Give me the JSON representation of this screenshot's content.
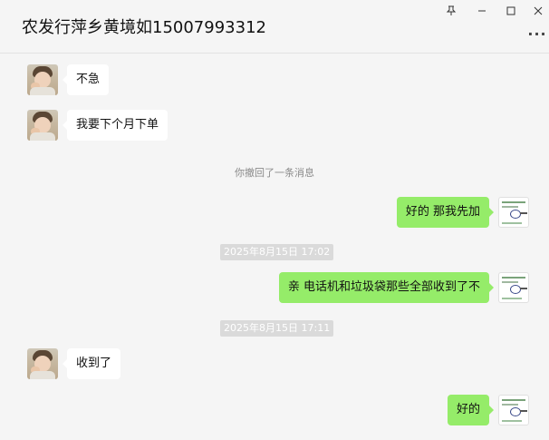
{
  "window": {
    "title": "农发行萍乡黄境如15007993312",
    "pin_icon": "pin-icon",
    "minimize_icon": "minimize-icon",
    "maximize_icon": "maximize-icon",
    "close_icon": "close-icon",
    "more_icon": "more-icon"
  },
  "messages": [
    {
      "direction": "in",
      "text": "不急"
    },
    {
      "direction": "in",
      "text": "我要下个月下单"
    },
    {
      "system": "你撤回了一条消息"
    },
    {
      "direction": "out",
      "text": "好的 那我先加"
    },
    {
      "timestamp": "2025年8月15日 17:02"
    },
    {
      "direction": "out",
      "text": "亲 电话机和垃圾袋那些全部收到了不"
    },
    {
      "timestamp": "2025年8月15日 17:11"
    },
    {
      "direction": "in",
      "text": "收到了"
    },
    {
      "direction": "out",
      "text": "好的"
    }
  ],
  "colors": {
    "outgoing_bubble": "#95ec69",
    "incoming_bubble": "#ffffff",
    "background": "#f5f5f5"
  }
}
